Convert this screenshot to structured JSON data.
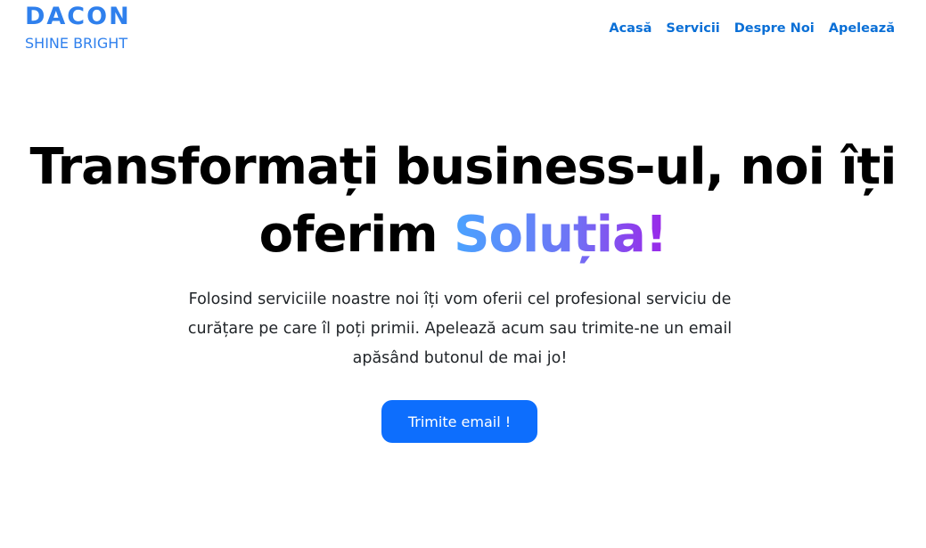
{
  "brand": {
    "name": "DACON",
    "tagline": "SHINE BRIGHT"
  },
  "nav": {
    "items": [
      {
        "label": "Acasă"
      },
      {
        "label": "Servicii"
      },
      {
        "label": "Despre Noi"
      },
      {
        "label": "Apelează"
      }
    ]
  },
  "hero": {
    "title_line1": "Transformați business-ul, noi îți",
    "title_line2_prefix": "oferim ",
    "title_highlight": "Soluția!",
    "description": "Folosind serviciile noastre noi îți vom oferii cel profesional serviciu de curățare pe care îl poți primii. Apelează acum sau trimite-ne un email apăsând butonul de mai jo!",
    "cta_label": "Trimite email !"
  },
  "colors": {
    "brand": "#2f80ed",
    "nav_link": "#0a6fd6",
    "button": "#0d6efd",
    "gradient_start": "#4aa3ff",
    "gradient_end": "#9b26e8"
  }
}
